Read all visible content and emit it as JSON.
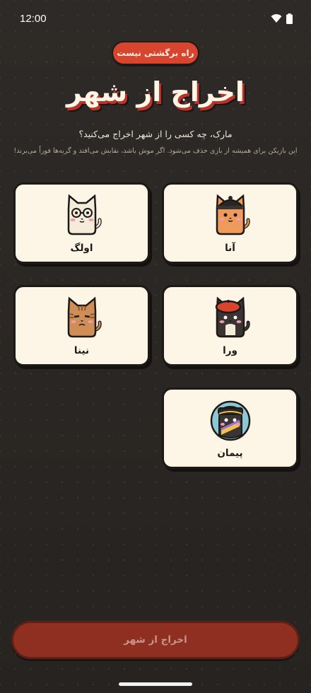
{
  "status_bar": {
    "time": "12:00"
  },
  "banner": {
    "text": "راه برگشتی نیست"
  },
  "title": "اخراج از شهر",
  "question": "مارک، چه کسی را از شهر اخراج می‌کنید؟",
  "hint": "این بازیکن برای همیشه از بازی حذف می‌شود. اگر موش باشد، نقابش می‌افتد و گربه‌ها فوراً می‌برند!",
  "players": [
    {
      "name": "آنا",
      "avatar": "cat-black-beanie-icon"
    },
    {
      "name": "اولگ",
      "avatar": "cat-white-glasses-icon"
    },
    {
      "name": "ورا",
      "avatar": "cat-black-red-beret-icon"
    },
    {
      "name": "نینا",
      "avatar": "cat-tabby-icon"
    },
    {
      "name": "پیمان",
      "avatar": "cat-sailor-hat-icon"
    }
  ],
  "action_button": {
    "label": "اخراج از شهر"
  },
  "colors": {
    "accent_red": "#d8452e",
    "button_disabled": "#8f2f22",
    "card_bg": "#fdf6e7",
    "background": "#2b2724"
  }
}
